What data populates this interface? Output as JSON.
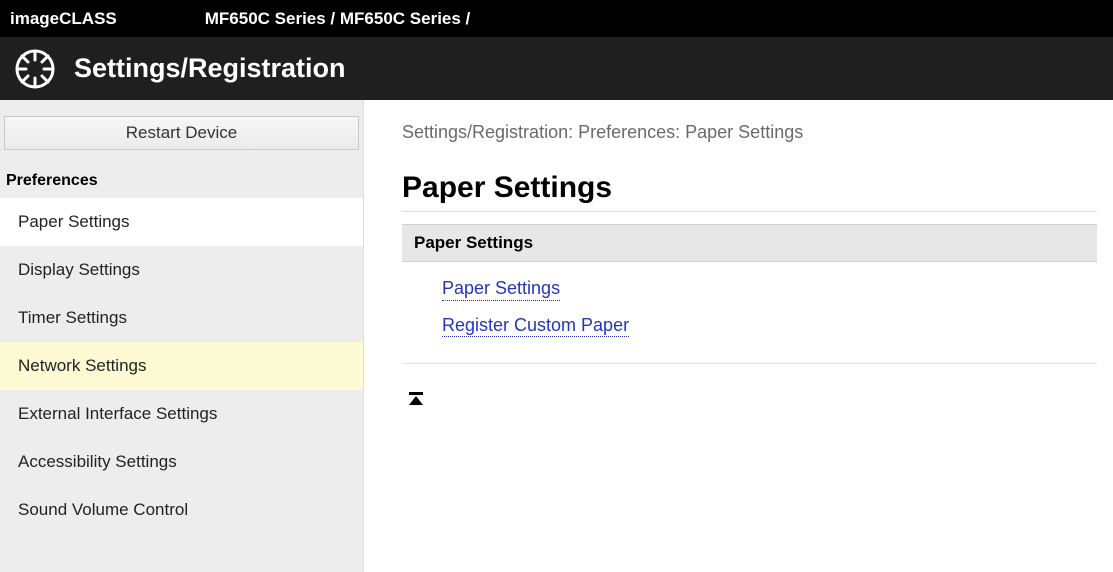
{
  "top": {
    "brand": "imageCLASS",
    "model_line": "MF650C Series / MF650C Series /"
  },
  "title_bar": {
    "title": "Settings/Registration"
  },
  "sidebar": {
    "restart_label": "Restart Device",
    "section_label": "Preferences",
    "items": [
      {
        "label": "Paper Settings",
        "state": "active"
      },
      {
        "label": "Display Settings",
        "state": ""
      },
      {
        "label": "Timer Settings",
        "state": ""
      },
      {
        "label": "Network Settings",
        "state": "hovered"
      },
      {
        "label": "External Interface Settings",
        "state": ""
      },
      {
        "label": "Accessibility Settings",
        "state": ""
      },
      {
        "label": "Sound Volume Control",
        "state": ""
      }
    ]
  },
  "main": {
    "breadcrumb": "Settings/Registration: Preferences: Paper Settings",
    "page_title": "Paper Settings",
    "panel_header": "Paper Settings",
    "links": [
      "Paper Settings",
      "Register Custom Paper"
    ]
  }
}
